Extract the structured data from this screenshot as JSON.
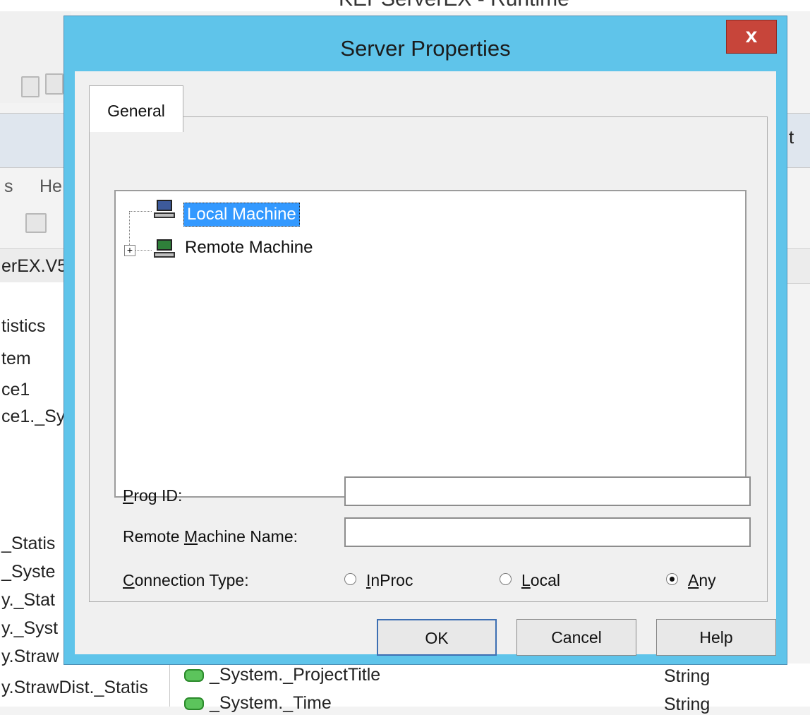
{
  "background_app": {
    "title_fragment": "KEPServerEX - Runtime",
    "menu_fragments": [
      "s",
      "He"
    ],
    "header_fragment": "t",
    "tree_items": [
      "erEX.V5",
      "tistics",
      "tem",
      "ce1",
      "ce1._Sy",
      "_Statis",
      "_Syste",
      "y._Stat",
      "y._Syst",
      "y.Straw",
      "y.StrawDist._Statis"
    ],
    "list_rows": [
      {
        "name": "_System._ProjectTitle",
        "type": "String"
      },
      {
        "name": "_System._Time",
        "type": "String"
      }
    ]
  },
  "dialog": {
    "title": "Server Properties",
    "close_label": "x",
    "tab": "General",
    "tree": {
      "local": "Local Machine",
      "remote": "Remote Machine",
      "expander": "+"
    },
    "form": {
      "prog_id_label_u": "P",
      "prog_id_label_rest": "rog ID:",
      "prog_id_value": "",
      "remote_label_pre": "Remote ",
      "remote_label_u": "M",
      "remote_label_rest": "achine Name:",
      "remote_value": "",
      "conn_label_u": "C",
      "conn_label_rest": "onnection Type:",
      "radio_inproc_u": "I",
      "radio_inproc_rest": "nProc",
      "radio_local_u": "L",
      "radio_local_rest": "ocal",
      "radio_any_u": "A",
      "radio_any_rest": "ny",
      "selected": "Any"
    },
    "buttons": {
      "ok": "OK",
      "cancel": "Cancel",
      "help": "Help"
    }
  }
}
